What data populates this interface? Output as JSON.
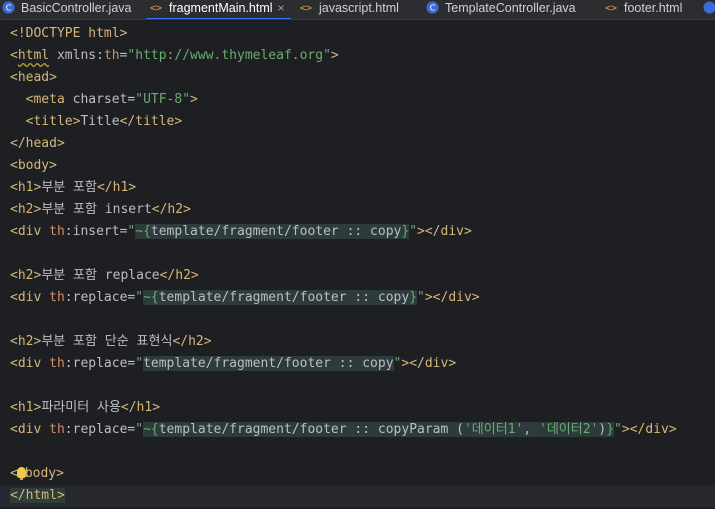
{
  "tabs": [
    {
      "label": "BasicController.java",
      "icon": "class-icon",
      "active": false
    },
    {
      "label": "fragmentMain.html",
      "icon": "html-icon",
      "active": true,
      "close": "×"
    },
    {
      "label": "javascript.html",
      "icon": "html-icon",
      "active": false
    },
    {
      "label": "TemplateController.java",
      "icon": "class-icon",
      "active": false
    },
    {
      "label": "footer.html",
      "icon": "html-icon",
      "active": false
    }
  ],
  "code": {
    "l1": {
      "a": "<!DOCTYPE html>"
    },
    "l2": {
      "lt": "<",
      "tag": "html",
      "sp": " ",
      "attr": "xmlns:",
      "ns": "th",
      "eq": "=",
      "val": "\"http://www.thymeleaf.org\"",
      "gt": ">"
    },
    "l3": {
      "tag": "<head>"
    },
    "l4": {
      "open": "<meta ",
      "attr": "charset",
      "eq": "=",
      "val": "\"UTF-8\"",
      "gt": ">"
    },
    "l5": {
      "open": "<title>",
      "text": "Title",
      "close": "</title>"
    },
    "l6": {
      "tag": "</head>"
    },
    "l7": {
      "tag": "<body>"
    },
    "l8": {
      "open": "<h1>",
      "text": "부분 포함",
      "close": "</h1>"
    },
    "l9": {
      "open": "<h2>",
      "text": "부분 포함 insert",
      "close": "</h2>"
    },
    "l10": {
      "open": "<div ",
      "ns": "th",
      "attr": ":insert",
      "eq": "=",
      "q1": "\"",
      "brace1": "~{",
      "frag": "template/fragment/footer :: copy",
      "brace2": "}",
      "q2": "\"",
      "gt": ">",
      "close": "</div>"
    },
    "l12": {
      "open": "<h2>",
      "text": "부분 포함 replace",
      "close": "</h2>"
    },
    "l13": {
      "open": "<div ",
      "ns": "th",
      "attr": ":replace",
      "eq": "=",
      "q1": "\"",
      "brace1": "~{",
      "frag": "template/fragment/footer :: copy",
      "brace2": "}",
      "q2": "\"",
      "gt": ">",
      "close": "</div>"
    },
    "l15": {
      "open": "<h2>",
      "text": "부분 포함 단순 표현식",
      "close": "</h2>"
    },
    "l16": {
      "open": "<div ",
      "ns": "th",
      "attr": ":replace",
      "eq": "=",
      "q1": "\"",
      "frag": "template/fragment/footer :: copy",
      "q2": "\"",
      "gt": ">",
      "close": "</div>"
    },
    "l18": {
      "open": "<h1>",
      "text": "파라미터 사용",
      "close": "</h1>"
    },
    "l19": {
      "open": "<div ",
      "ns": "th",
      "attr": ":replace",
      "eq": "=",
      "q1": "\"",
      "brace1": "~{",
      "frag": "template/fragment/footer :: copyParam (",
      "p1": "'데이터1'",
      "comma": ", ",
      "p2": "'데이터2'",
      "paren": ")",
      "brace2": "}",
      "q2": "\"",
      "gt": ">",
      "close": "</div>"
    },
    "l21": {
      "lt": "<",
      "rest": "body>"
    },
    "l22": {
      "tag": "</html>"
    }
  },
  "colors": {
    "tag": "#d5b778",
    "string": "#6aab73",
    "namespace": "#cf8e6d",
    "text": "#bcbec4",
    "background": "#1e1f22",
    "accent": "#3574f0"
  }
}
